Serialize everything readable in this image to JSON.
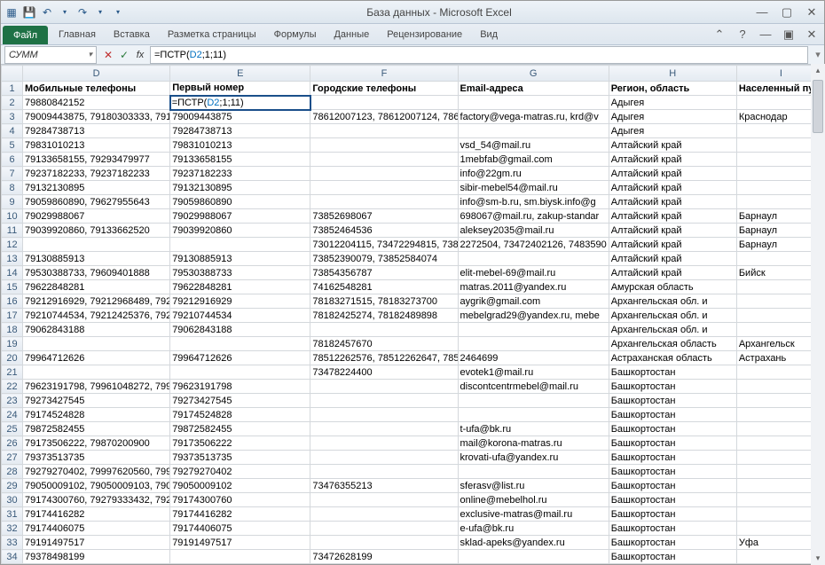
{
  "title": "База данных - Microsoft Excel",
  "qat": {
    "save": "💾",
    "undo": "↶",
    "redo": "↷"
  },
  "tabs": {
    "file": "Файл",
    "items": [
      "Главная",
      "Вставка",
      "Разметка страницы",
      "Формулы",
      "Данные",
      "Рецензирование",
      "Вид"
    ]
  },
  "name_box": "СУММ",
  "formula_prefix": "=ПСТР(",
  "formula_ref": "D2",
  "formula_suffix": ";1;11)",
  "columns": [
    "",
    "D",
    "E",
    "F",
    "G",
    "H",
    "I"
  ],
  "headers": {
    "D": "Мобильные телефоны",
    "E": "Первый номер",
    "F": "Городские телефоны",
    "G": "Email-адреса",
    "H": "Регион, область",
    "I": "Населенный пункт"
  },
  "edit_cell": {
    "prefix": "=ПСТР(",
    "ref": "D2",
    "suffix": ";1;11)"
  },
  "rows": [
    {
      "n": 2,
      "D": "79880842152",
      "E": "__EDIT__",
      "F": "",
      "G": "",
      "H": "Адыгея",
      "I": ""
    },
    {
      "n": 3,
      "D": "79009443875, 79180303333, 7918",
      "E": "79009443875",
      "F": "78612007123, 78612007124, 7861",
      "G": "factory@vega-matras.ru, krd@v",
      "H": "Адыгея",
      "I": "Краснодар"
    },
    {
      "n": 4,
      "D": "79284738713",
      "E": "79284738713",
      "F": "",
      "G": "",
      "H": "Адыгея",
      "I": ""
    },
    {
      "n": 5,
      "D": "79831010213",
      "E": "79831010213",
      "F": "",
      "G": "vsd_54@mail.ru",
      "H": "Алтайский край",
      "I": ""
    },
    {
      "n": 6,
      "D": "79133658155, 79293479977",
      "E": "79133658155",
      "F": "",
      "G": "1mebfab@gmail.com",
      "H": "Алтайский край",
      "I": ""
    },
    {
      "n": 7,
      "D": "79237182233, 79237182233",
      "E": "79237182233",
      "F": "",
      "G": "info@22gm.ru",
      "H": "Алтайский край",
      "I": ""
    },
    {
      "n": 8,
      "D": "79132130895",
      "E": "79132130895",
      "F": "",
      "G": "sibir-mebel54@mail.ru",
      "H": "Алтайский край",
      "I": ""
    },
    {
      "n": 9,
      "D": "79059860890, 79627955643",
      "E": "79059860890",
      "F": "",
      "G": "info@sm-b.ru, sm.biysk.info@g",
      "H": "Алтайский край",
      "I": ""
    },
    {
      "n": 10,
      "D": "79029988067",
      "E": "79029988067",
      "F": "73852698067",
      "G": "698067@mail.ru, zakup-standar",
      "H": "Алтайский край",
      "I": "Барнаул"
    },
    {
      "n": 11,
      "D": "79039920860, 79133662520",
      "E": "79039920860",
      "F": "73852464536",
      "G": "aleksey2035@mail.ru",
      "H": "Алтайский край",
      "I": "Барнаул"
    },
    {
      "n": 12,
      "D": "",
      "E": "",
      "F": "73012204115, 73472294815, 7385",
      "G": "2272504, 73472402126, 7483590",
      "H": "Алтайский край",
      "I": "Барнаул"
    },
    {
      "n": 13,
      "D": "79130885913",
      "E": "79130885913",
      "F": "73852390079, 73852584074",
      "G": "",
      "H": "Алтайский край",
      "I": ""
    },
    {
      "n": 14,
      "D": "79530388733, 79609401888",
      "E": "79530388733",
      "F": "73854356787",
      "G": "elit-mebel-69@mail.ru",
      "H": "Алтайский край",
      "I": "Бийск"
    },
    {
      "n": 15,
      "D": "79622848281",
      "E": "79622848281",
      "F": "74162548281",
      "G": "matras.2011@yandex.ru",
      "H": "Амурская область",
      "I": ""
    },
    {
      "n": 16,
      "D": "79212916929, 79212968489, 7921",
      "E": "79212916929",
      "F": "78183271515, 78183273700",
      "G": "aygrik@gmail.com",
      "H": "Архангельская обл. и",
      "I": ""
    },
    {
      "n": 17,
      "D": "79210744534, 79212425376, 7921",
      "E": "79210744534",
      "F": "78182425274, 78182489898",
      "G": "mebelgrad29@yandex.ru, mebe",
      "H": "Архангельская обл. и",
      "I": ""
    },
    {
      "n": 18,
      "D": "79062843188",
      "E": "79062843188",
      "F": "",
      "G": "",
      "H": "Архангельская обл. и",
      "I": ""
    },
    {
      "n": 19,
      "D": "",
      "E": "",
      "F": "78182457670",
      "G": "",
      "H": "Архангельская область",
      "I": "Архангельск"
    },
    {
      "n": 20,
      "D": "79964712626",
      "E": "79964712626",
      "F": "78512262576, 78512262647, 7851",
      "G": "2464699",
      "H": "Астраханская область",
      "I": "Астрахань"
    },
    {
      "n": 21,
      "D": "",
      "E": "",
      "F": "73478224400",
      "G": "evotek1@mail.ru",
      "H": "Башкортостан",
      "I": ""
    },
    {
      "n": 22,
      "D": "79623191798, 79961048272, 7996",
      "E": "79623191798",
      "F": "",
      "G": "discontcentrmebel@mail.ru",
      "H": "Башкортостан",
      "I": ""
    },
    {
      "n": 23,
      "D": "79273427545",
      "E": "79273427545",
      "F": "",
      "G": "",
      "H": "Башкортостан",
      "I": ""
    },
    {
      "n": 24,
      "D": "79174524828",
      "E": "79174524828",
      "F": "",
      "G": "",
      "H": "Башкортостан",
      "I": ""
    },
    {
      "n": 25,
      "D": "79872582455",
      "E": "79872582455",
      "F": "",
      "G": "t-ufa@bk.ru",
      "H": "Башкортостан",
      "I": ""
    },
    {
      "n": 26,
      "D": "79173506222, 79870200900",
      "E": "79173506222",
      "F": "",
      "G": "mail@korona-matras.ru",
      "H": "Башкортостан",
      "I": ""
    },
    {
      "n": 27,
      "D": "79373513735",
      "E": "79373513735",
      "F": "",
      "G": "krovati-ufa@yandex.ru",
      "H": "Башкортостан",
      "I": ""
    },
    {
      "n": 28,
      "D": "79279270402, 79997620560, 7999",
      "E": "79279270402",
      "F": "",
      "G": "",
      "H": "Башкортостан",
      "I": ""
    },
    {
      "n": 29,
      "D": "79050009102, 79050009103, 7905",
      "E": "79050009102",
      "F": "73476355213",
      "G": "sferasv@list.ru",
      "H": "Башкортостан",
      "I": ""
    },
    {
      "n": 30,
      "D": "79174300760, 79279333432, 7927",
      "E": "79174300760",
      "F": "",
      "G": "online@mebelhol.ru",
      "H": "Башкортостан",
      "I": ""
    },
    {
      "n": 31,
      "D": "79174416282",
      "E": "79174416282",
      "F": "",
      "G": "exclusive-matras@mail.ru",
      "H": "Башкортостан",
      "I": ""
    },
    {
      "n": 32,
      "D": "79174406075",
      "E": "79174406075",
      "F": "",
      "G": "e-ufa@bk.ru",
      "H": "Башкортостан",
      "I": ""
    },
    {
      "n": 33,
      "D": "79191497517",
      "E": "79191497517",
      "F": "",
      "G": "sklad-apeks@yandex.ru",
      "H": "Башкортостан",
      "I": "Уфа"
    },
    {
      "n": 34,
      "D": "79378498199",
      "E": "",
      "F": "73472628199",
      "G": "",
      "H": "Башкортостан",
      "I": ""
    }
  ]
}
